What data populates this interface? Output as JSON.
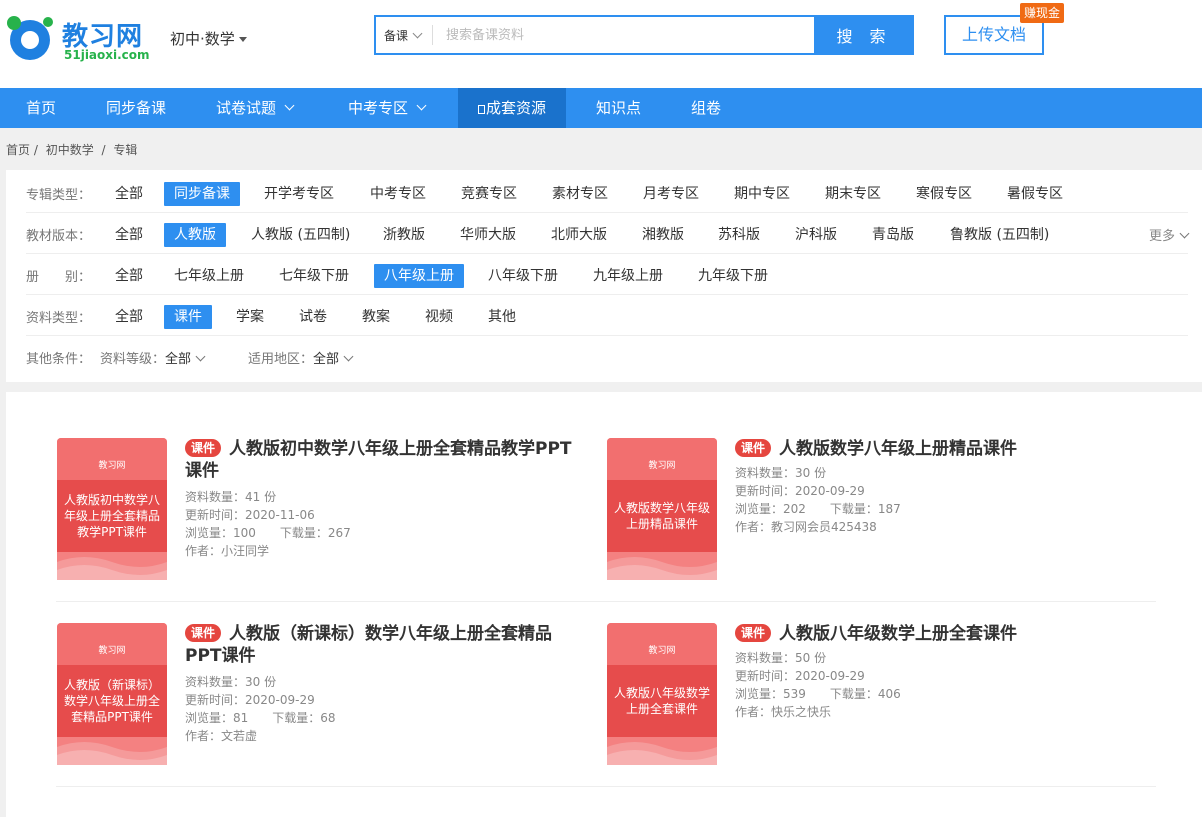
{
  "header": {
    "logo_text": "教习网",
    "logo_sub": "51jiaoxi.com",
    "subject": "初中·数学",
    "search": {
      "type": "备课",
      "placeholder": "搜索备课资料",
      "button": "搜 索"
    },
    "upload": "上传文档",
    "earn_badge": "赚现金"
  },
  "nav": [
    {
      "label": "首页"
    },
    {
      "label": "同步备课"
    },
    {
      "label": "试卷试题"
    },
    {
      "label": "中考专区"
    },
    {
      "label": "成套资源"
    },
    {
      "label": "知识点"
    },
    {
      "label": "组卷"
    }
  ],
  "breadcrumb": [
    "首页 /",
    "初中数学",
    "/",
    "专辑"
  ],
  "filters": {
    "album_type": {
      "label": "专辑类型：",
      "options": [
        "全部",
        "同步备课",
        "开学考专区",
        "中考专区",
        "竞赛专区",
        "素材专区",
        "月考专区",
        "期中专区",
        "期末专区",
        "寒假专区",
        "暑假专区"
      ],
      "selected": "同步备课"
    },
    "edition": {
      "label": "教材版本：",
      "options": [
        "全部",
        "人教版",
        "人教版 (五四制)",
        "浙教版",
        "华师大版",
        "北师大版",
        "湘教版",
        "苏科版",
        "沪科版",
        "青岛版",
        "鲁教版 (五四制)"
      ],
      "selected": "人教版",
      "more": "更多"
    },
    "volume": {
      "label": "册　　别：",
      "options": [
        "全部",
        "七年级上册",
        "七年级下册",
        "八年级上册",
        "八年级下册",
        "九年级上册",
        "九年级下册"
      ],
      "selected": "八年级上册"
    },
    "resource_type": {
      "label": "资料类型：",
      "options": [
        "全部",
        "课件",
        "学案",
        "试卷",
        "教案",
        "视频",
        "其他"
      ],
      "selected": "课件"
    },
    "other": {
      "label": "其他条件：",
      "level_label": "资料等级：",
      "level_value": "全部",
      "region_label": "适用地区：",
      "region_value": "全部"
    }
  },
  "cards": [
    {
      "tag": "课件",
      "title": "人教版初中数学八年级上册全套精品教学PPT课件",
      "thumb_title": "人教版初中数学八年级上册全套精品教学PPT课件",
      "thumb_logo": "教习网",
      "count": "资料数量：41 份",
      "updated": "更新时间：2020-11-06",
      "views": "浏览量：100",
      "downloads": "下载量：267",
      "author": "作者：小汪同学"
    },
    {
      "tag": "课件",
      "title": "人教版数学八年级上册精品课件",
      "thumb_title": "人教版数学八年级上册精品课件",
      "thumb_logo": "教习网",
      "count": "资料数量：30 份",
      "updated": "更新时间：2020-09-29",
      "views": "浏览量：202",
      "downloads": "下载量：187",
      "author": "作者：教习网会员425438"
    },
    {
      "tag": "课件",
      "title": "人教版（新课标）数学八年级上册全套精品PPT课件",
      "thumb_title": "人教版（新课标）数学八年级上册全套精品PPT课件",
      "thumb_logo": "教习网",
      "count": "资料数量：30 份",
      "updated": "更新时间：2020-09-29",
      "views": "浏览量：81",
      "downloads": "下载量：68",
      "author": "作者：文若虚"
    },
    {
      "tag": "课件",
      "title": "人教版八年级数学上册全套课件",
      "thumb_title": "人教版八年级数学上册全套课件",
      "thumb_logo": "教习网",
      "count": "资料数量：50 份",
      "updated": "更新时间：2020-09-29",
      "views": "浏览量：539",
      "downloads": "下载量：406",
      "author": "作者：快乐之快乐"
    }
  ],
  "colors": {
    "brand_blue": "#2e8ff0",
    "tag_red": "#e5463f",
    "thumb_red": "#e64c4c",
    "badge_orange": "#f06a14"
  }
}
